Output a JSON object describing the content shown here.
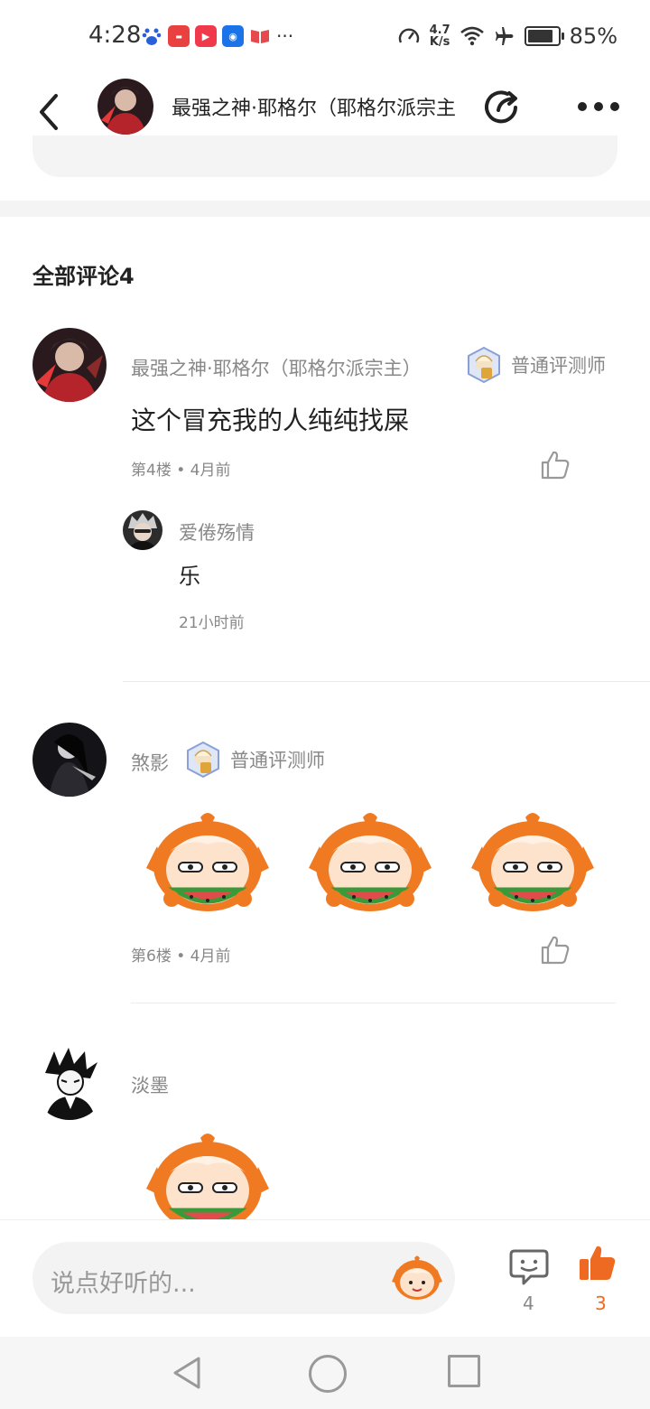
{
  "status_bar": {
    "time": "4:28",
    "notif_more": "···",
    "net_speed_value": "4.7",
    "net_speed_unit": "K/s",
    "battery_level": 85,
    "battery_text": "85%"
  },
  "header": {
    "title": "最强之神·耶格尔（耶格尔派宗主）"
  },
  "comments": {
    "section_title": "全部评论4",
    "items": [
      {
        "username": "最强之神·耶格尔（耶格尔派宗主）",
        "badge": "普通评测师",
        "text": "这个冒充我的人纯纯找屎",
        "floor": "第4楼",
        "time": "4月前",
        "reply": {
          "username": "爱倦殇情",
          "text": "乐",
          "time": "21小时前"
        }
      },
      {
        "username": "煞影",
        "badge": "普通评测师",
        "floor": "第6楼",
        "time": "4月前"
      },
      {
        "username": "淡墨"
      }
    ]
  },
  "bottom_bar": {
    "input_placeholder": "说点好听的...",
    "comment_count": "4",
    "like_count": "3"
  },
  "colors": {
    "accent": "#ee6a22",
    "muted": "#888888"
  }
}
